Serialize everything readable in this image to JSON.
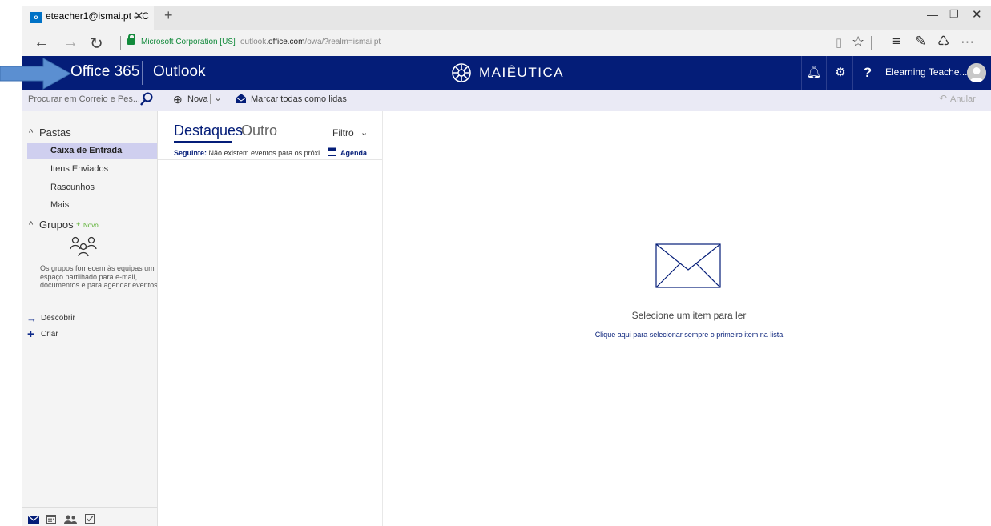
{
  "browser": {
    "tab_title": "eteacher1@ismai.pt – C",
    "tab_icon_text": "o",
    "new_tab": "+",
    "certificate": "Microsoft Corporation [US]",
    "url_prefix": "outlook.",
    "url_domain": "office.com",
    "url_path": "/owa/?realm=ismai.pt",
    "icons": [
      "back-icon",
      "forward-icon",
      "refresh-icon",
      "lock-icon",
      "reading-view-icon",
      "favorite-star-icon",
      "hub-icon",
      "web-note-icon",
      "share-icon",
      "more-icon"
    ]
  },
  "header": {
    "suite": "Office 365",
    "app": "Outlook",
    "brand": "MAIÊUTICA",
    "user": "Elearning Teache...",
    "help": "?",
    "color": "#041d78"
  },
  "commands": {
    "search_placeholder": "Procurar em Correio e Pes...",
    "new_label": "Nova",
    "mark_all_read": "Marcar todas como lidas",
    "undo": "Anular"
  },
  "folders": {
    "section": "Pastas",
    "items": [
      "Caixa de Entrada",
      "Itens Enviados",
      "Rascunhos",
      "Mais"
    ],
    "selected": "Caixa de Entrada"
  },
  "groups": {
    "section": "Grupos",
    "new_label": "Novo",
    "description": "Os grupos fornecem às equipas um espaço partilhado para e-mail, documentos e para agendar eventos.",
    "discover": "Descobrir",
    "create": "Criar"
  },
  "message_list": {
    "tab_focused": "Destaques",
    "tab_other": "Outro",
    "filter": "Filtro",
    "next_label": "Seguinte:",
    "next_text": "Não existem eventos para os próxi",
    "agenda": "Agenda"
  },
  "reading_pane": {
    "empty_title": "Selecione um item para ler",
    "empty_link": "Clique aqui para selecionar sempre o primeiro item na lista"
  },
  "bottom_nav": [
    "mail-icon",
    "calendar-icon",
    "people-icon",
    "tasks-icon"
  ]
}
